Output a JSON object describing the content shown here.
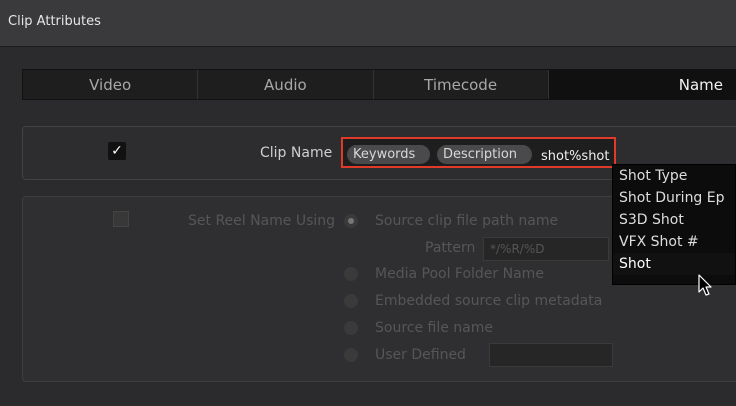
{
  "window": {
    "title": "Clip Attributes"
  },
  "tabs": [
    {
      "label": "Video"
    },
    {
      "label": "Audio"
    },
    {
      "label": "Timecode"
    },
    {
      "label": "Name",
      "active": true
    }
  ],
  "clip_name": {
    "checked": true,
    "check_glyph": "✓",
    "label": "Clip Name",
    "tokens": [
      "Keywords",
      "Description"
    ],
    "typed_text": "shot%shot"
  },
  "dropdown": {
    "items": [
      "Shot Type",
      "Shot During Ep",
      "S3D Shot",
      "VFX Shot #",
      "Shot"
    ],
    "selected_index": 4
  },
  "reel_name": {
    "label": "Set Reel Name Using",
    "options": [
      "Source clip file path name",
      "Media Pool Folder Name",
      "Embedded source clip metadata",
      "Source file name",
      "User Defined"
    ],
    "pattern_label": "Pattern",
    "pattern_value": "*/%R/%D"
  },
  "colors": {
    "accent_red": "#e23a2a",
    "background": "#2b2b2d"
  }
}
